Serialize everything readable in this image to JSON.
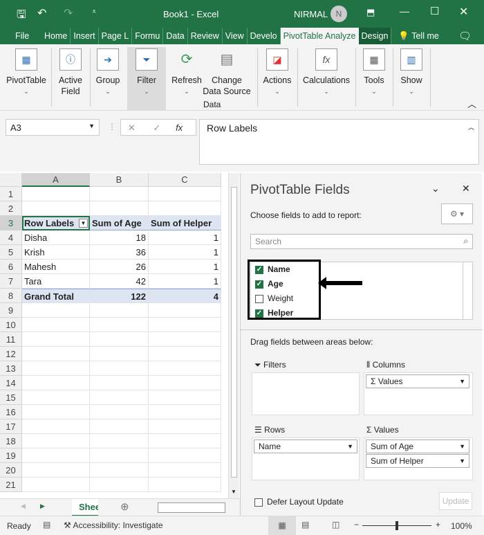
{
  "title": {
    "doc": "Book1  -  Excel",
    "user": "NIRMAL",
    "avatar": "N"
  },
  "tabs": [
    "File",
    "Home",
    "Insert",
    "Page L",
    "Formu",
    "Data",
    "Review",
    "View",
    "Develo",
    "PivotTable Analyze",
    "Design",
    "Tell me"
  ],
  "ribbon": {
    "pivottable": "PivotTable",
    "active_field": "Active Field",
    "group": "Group",
    "filter": "Filter",
    "refresh": "Refresh",
    "change_data_source": "Change Data Source",
    "data_group": "Data",
    "actions": "Actions",
    "calculations": "Calculations",
    "tools": "Tools",
    "show": "Show"
  },
  "formula": {
    "namebox": "A3",
    "fx": "fx",
    "content": "Row Labels"
  },
  "sheet": {
    "columns": [
      "A",
      "B",
      "C"
    ],
    "rows": [
      "1",
      "2",
      "3",
      "4",
      "5",
      "6",
      "7",
      "8",
      "9",
      "10",
      "11",
      "12",
      "13",
      "14",
      "15",
      "16",
      "17",
      "18",
      "19",
      "20",
      "21"
    ],
    "headers": [
      "Row Labels",
      "Sum of Age",
      "Sum of Helper"
    ],
    "data": [
      [
        "Disha",
        "18",
        "1"
      ],
      [
        "Krish",
        "36",
        "1"
      ],
      [
        "Mahesh",
        "26",
        "1"
      ],
      [
        "Tara",
        "42",
        "1"
      ]
    ],
    "total": [
      "Grand Total",
      "122",
      "4"
    ],
    "tab": "Shee ..."
  },
  "pane": {
    "title": "PivotTable Fields",
    "choose": "Choose fields to add to report:",
    "search_placeholder": "Search",
    "fields": [
      {
        "name": "Name",
        "checked": true
      },
      {
        "name": "Age",
        "checked": true
      },
      {
        "name": "Weight",
        "checked": false
      },
      {
        "name": "Helper",
        "checked": true
      }
    ],
    "drag": "Drag fields between areas below:",
    "filters": "Filters",
    "columns": "Columns",
    "rows": "Rows",
    "values": "Values",
    "columns_items": [
      "Σ Values"
    ],
    "rows_items": [
      "Name"
    ],
    "values_items": [
      "Sum of Age",
      "Sum of Helper"
    ],
    "defer": "Defer Layout Update",
    "update": "Update"
  },
  "status": {
    "ready": "Ready",
    "accessibility": "Accessibility: Investigate",
    "zoom": "100%"
  }
}
